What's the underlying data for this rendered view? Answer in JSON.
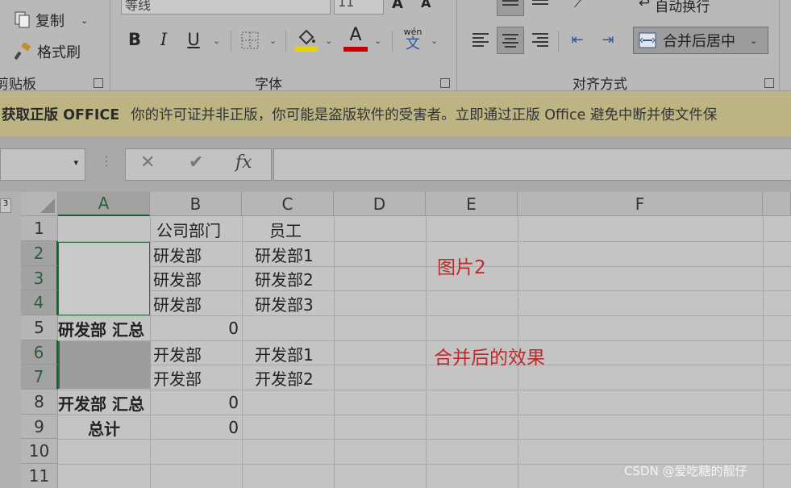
{
  "ribbon": {
    "copy_label": "复制",
    "format_painter_label": "格式刷",
    "clipboard_label": "剪贴板",
    "font_name_value": "等线",
    "font_size_value": "11",
    "bold_label": "B",
    "italic_label": "I",
    "underline_label": "U",
    "font_color_label": "A",
    "phonetic_label": "wén",
    "phonetic_char": "文",
    "font_group_label": "字体",
    "wrap_text_label": "自动换行",
    "merge_center_label": "合并后居中",
    "alignment_group_label": "对齐方式",
    "colors": {
      "highlight": "#e8d400",
      "font_color": "#c80000"
    }
  },
  "license_bar": {
    "head": "获取正版 OFFICE",
    "text": "你的许可证并非正版，你可能是盗版软件的受害者。立即通过正版 Office 避免中断并使文件保"
  },
  "formula_bar": {
    "cancel_icon": "✕",
    "enter_icon": "✔",
    "fx_label": "fx",
    "formula_value": ""
  },
  "sheet": {
    "corner_label": "3",
    "columns": [
      "A",
      "B",
      "C",
      "D",
      "E",
      "F"
    ],
    "rows": [
      "1",
      "2",
      "3",
      "4",
      "5",
      "6",
      "7",
      "8",
      "9",
      "10",
      "11"
    ],
    "cells": {
      "B1": "公司部门",
      "C1": "员工",
      "B2": "研发部",
      "C2": "研发部1",
      "B3": "研发部",
      "C3": "研发部2",
      "B4": "研发部",
      "C4": "研发部3",
      "A5": "研发部 汇总",
      "B5": "0",
      "B6": "开发部",
      "C6": "开发部1",
      "B7": "开发部",
      "C7": "开发部2",
      "A8": "开发部 汇总",
      "B8": "0",
      "A9": "总计",
      "B9": "0"
    },
    "annotations": {
      "picture_label": "图片2",
      "merge_effect_label": "合并后的效果"
    }
  },
  "watermark": "CSDN @爱吃糖的靓仔"
}
